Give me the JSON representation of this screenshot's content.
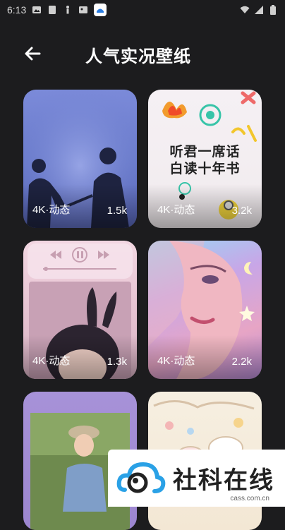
{
  "status_bar": {
    "time": "6:13"
  },
  "header": {
    "title": "人气实况壁纸"
  },
  "cards": [
    {
      "type": "4K·动态",
      "count": "1.5k"
    },
    {
      "type": "4K·动态",
      "count": "3.2k",
      "art_text_1": "听君一席话",
      "art_text_2": "白读十年书"
    },
    {
      "type": "4K·动态",
      "count": "1.3k"
    },
    {
      "type": "4K·动态",
      "count": "2.2k"
    },
    {
      "type": "",
      "count": ""
    },
    {
      "type": "",
      "count": ""
    }
  ],
  "watermark": {
    "text": "社科在线",
    "url": "cass.com.cn"
  },
  "colors": {
    "background": "#1c1c1e",
    "text": "#ffffff"
  }
}
